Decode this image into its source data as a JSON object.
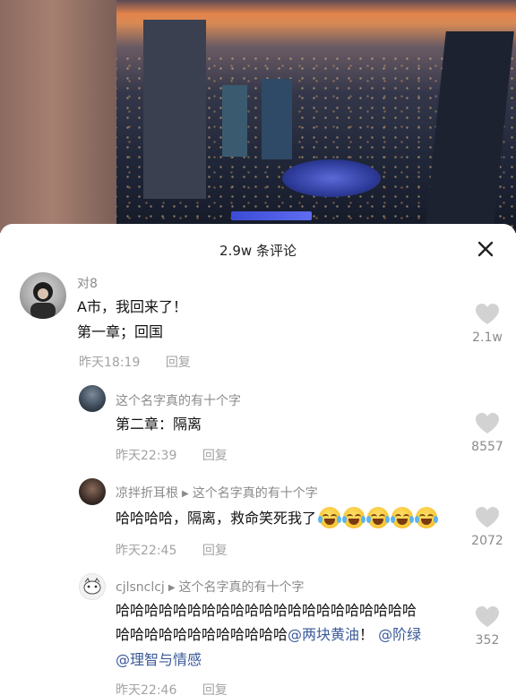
{
  "sheet": {
    "title": "2.9w 条评论",
    "close_label": "×"
  },
  "comments": [
    {
      "user": "对8",
      "lines": [
        "A市，我回来了！",
        "第一章；回国"
      ],
      "time": "昨天18:19",
      "reply": "回复",
      "likes": "2.1w"
    },
    {
      "user": "这个名字真的有十个字",
      "lines": [
        "第二章：隔离"
      ],
      "time": "昨天22:39",
      "reply": "回复",
      "likes": "8557"
    },
    {
      "user": "凉拌折耳根",
      "reply_to": "这个名字真的有十个字",
      "lines": [
        "哈哈哈哈，隔离，救命笑死我了"
      ],
      "emoji_count": 5,
      "time": "昨天22:45",
      "reply": "回复",
      "likes": "2072"
    },
    {
      "user": "cjlsnclcj",
      "reply_to": "这个名字真的有十个字",
      "line1": "哈哈哈哈哈哈哈哈哈哈哈哈哈哈哈哈哈哈哈哈哈",
      "line2_text": "哈哈哈哈哈哈哈哈哈哈哈哈",
      "mention1": "@两块黄油",
      "mid": "！",
      "mention2": "@阶绿",
      "mention3": "@理智与情感",
      "time": "昨天22:46",
      "reply": "回复",
      "likes": "352"
    }
  ]
}
